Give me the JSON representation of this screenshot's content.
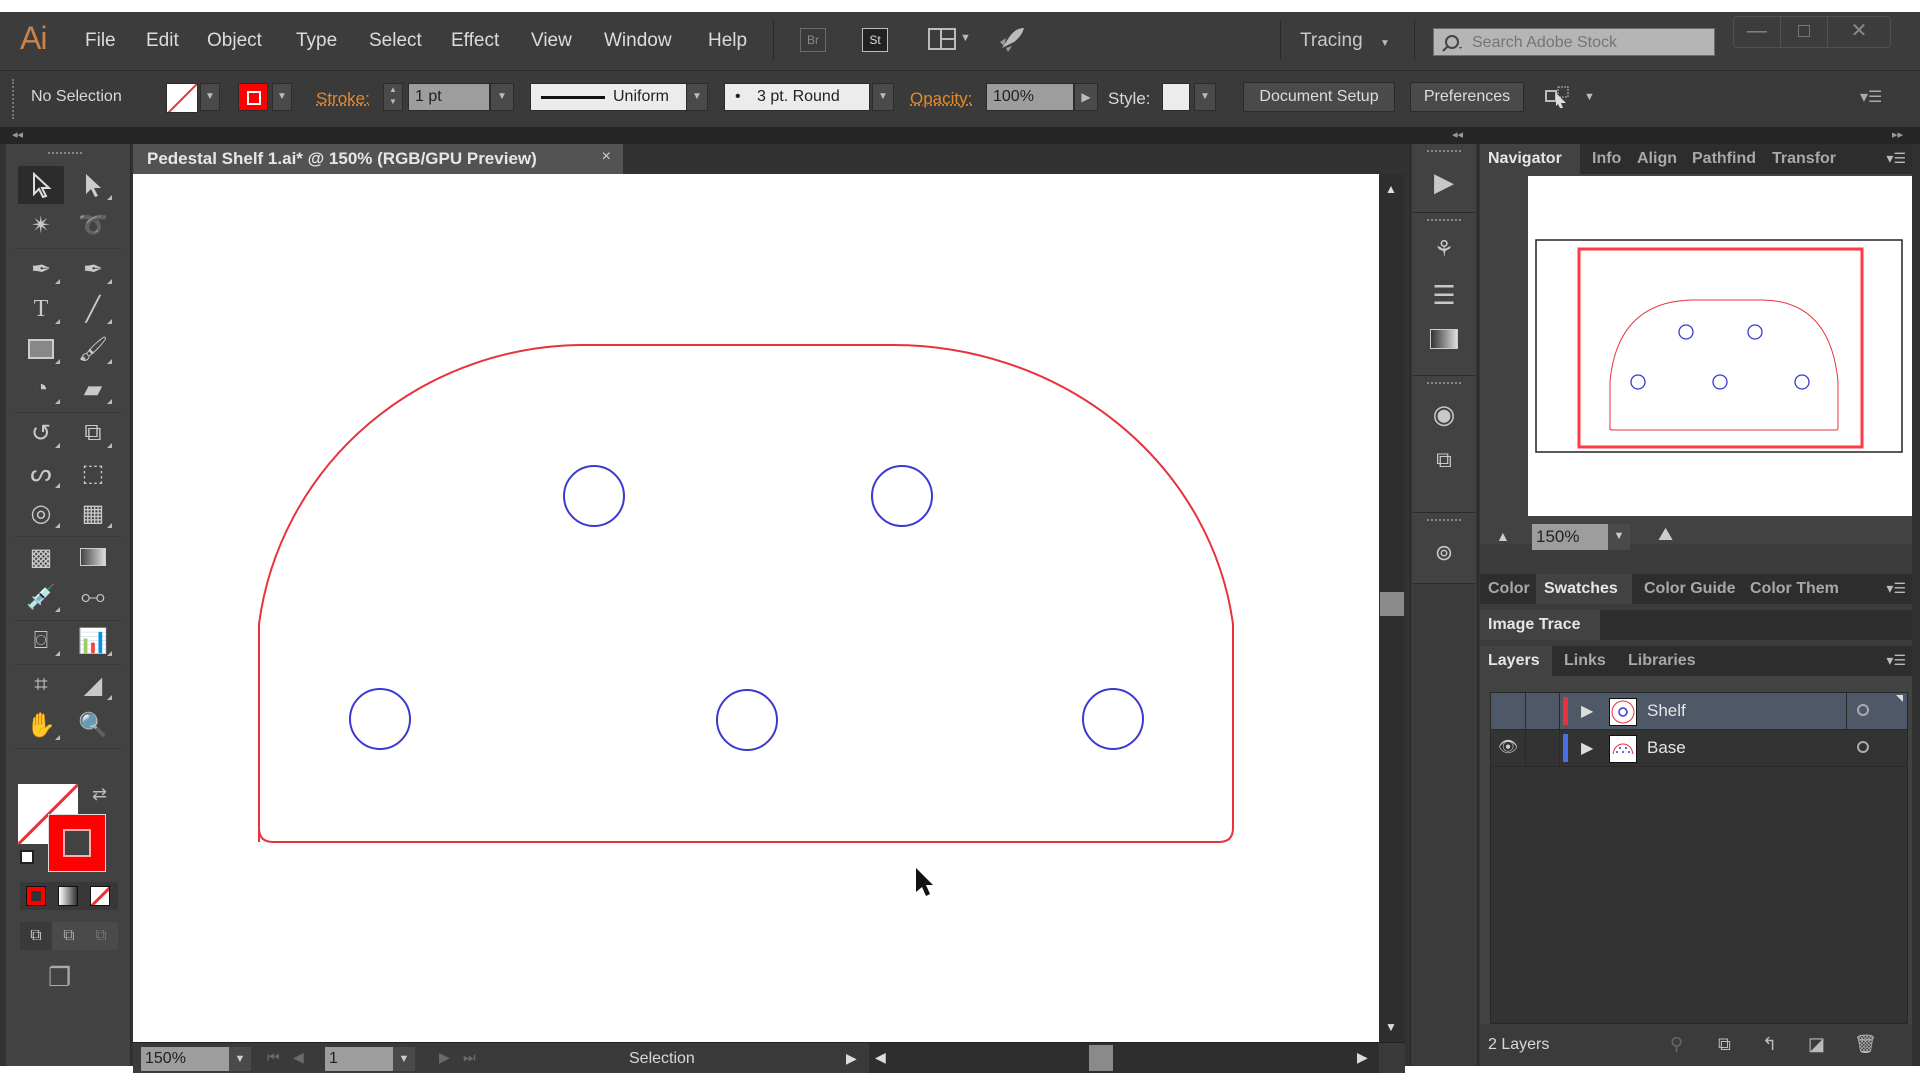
{
  "app": {
    "logo": "Ai",
    "menu": [
      "File",
      "Edit",
      "Object",
      "Type",
      "Select",
      "Effect",
      "View",
      "Window",
      "Help"
    ],
    "bridge_label": "Br",
    "stock_label": "St",
    "workspace": "Tracing",
    "search_placeholder": "Search Adobe Stock",
    "window_controls": {
      "minimize": "—",
      "maximize": "□",
      "close": "✕"
    }
  },
  "control_bar": {
    "selection_status": "No Selection",
    "stroke_label": "Stroke:",
    "stroke_weight": "1 pt",
    "profile": "Uniform",
    "brush": "3 pt. Round",
    "brush_dot": "•",
    "opacity_label": "Opacity:",
    "opacity_value": "100%",
    "style_label": "Style:",
    "document_setup": "Document Setup",
    "preferences": "Preferences"
  },
  "document": {
    "tab_title": "Pedestal Shelf 1.ai* @ 150% (RGB/GPU Preview)",
    "close": "×"
  },
  "artwork": {
    "outline_color": "#e8323c",
    "hole_color": "#3a3ad0",
    "hole_count": 5
  },
  "tools": {
    "fill_color": "#ffffff",
    "stroke_color": "#ff0000"
  },
  "status_bar": {
    "zoom": "150%",
    "artboard": "1",
    "current_tool": "Selection"
  },
  "panels": {
    "top_group": {
      "tabs": [
        "Navigator",
        "Info",
        "Align",
        "Pathfind",
        "Transfor"
      ],
      "active": "Navigator"
    },
    "navigator": {
      "zoom": "150%"
    },
    "color_group": {
      "tabs": [
        "Color",
        "Swatches",
        "Color Guide",
        "Color Them"
      ],
      "active": "Swatches"
    },
    "image_trace": {
      "tabs": [
        "Image Trace"
      ]
    },
    "layers_group": {
      "tabs": [
        "Layers",
        "Links",
        "Libraries"
      ],
      "active": "Layers"
    },
    "layers": [
      {
        "name": "Shelf",
        "color": "#e8323c",
        "visible": false,
        "selected": true
      },
      {
        "name": "Base",
        "color": "#4a6fe8",
        "visible": true,
        "selected": false
      }
    ],
    "layers_count": "2 Layers"
  },
  "colors": {
    "ui_bg": "#323232",
    "accent_orange": "#e08a2e",
    "logo": "#c8844a"
  }
}
